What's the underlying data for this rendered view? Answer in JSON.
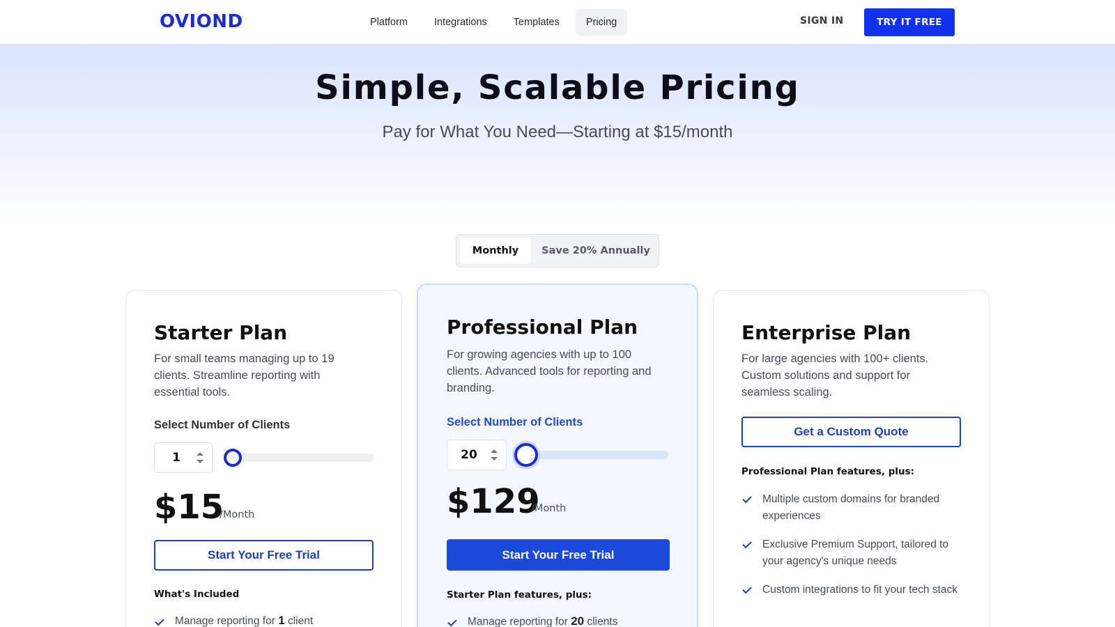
{
  "header": {
    "logo": "OVIOND",
    "nav": [
      "Platform",
      "Integrations",
      "Templates",
      "Pricing"
    ],
    "active_nav": "Pricing",
    "sign_in": "SIGN IN",
    "cta": "TRY IT FREE"
  },
  "hero": {
    "title": "Simple, Scalable Pricing",
    "subtitle": "Pay for What You Need—Starting at $15/month"
  },
  "billing_toggle": {
    "monthly": "Monthly",
    "annual": "Save 20% Annually",
    "selected": "Monthly"
  },
  "plans": {
    "starter": {
      "title": "Starter Plan",
      "description": "For small teams managing up to 19 clients. Streamline reporting with essential tools.",
      "select_label": "Select Number of Clients",
      "clients": "1",
      "slider_fraction": 0.0,
      "price": "$15",
      "period": "/Month",
      "cta": "Start Your Free Trial",
      "features_heading": "What's Included",
      "features": [
        {
          "pre": "Manage reporting for ",
          "num": "1",
          "post": " client"
        }
      ]
    },
    "pro": {
      "title": "Professional Plan",
      "description": "For growing agencies with up to 100 clients. Advanced tools for reporting and branding.",
      "select_label": "Select Number of Clients",
      "clients": "20",
      "slider_fraction": 0.0,
      "price": "$129",
      "period": "/Month",
      "cta": "Start Your Free Trial",
      "features_heading": "Starter Plan features, plus:",
      "features": [
        {
          "pre": "Manage reporting for ",
          "num": "20",
          "post": " clients"
        }
      ]
    },
    "enterprise": {
      "title": "Enterprise Plan",
      "description": "For large agencies with 100+ clients. Custom solutions and support for seamless scaling.",
      "cta": "Get a Custom Quote",
      "features_heading": "Professional Plan features, plus:",
      "features": [
        "Multiple custom domains for branded experiences",
        "Exclusive Premium Support, tailored to your agency's unique needs",
        "Custom integrations to fit your tech stack"
      ]
    }
  },
  "colors": {
    "brand": "#1b2bd6",
    "cta": "#1232f0",
    "accent_blue": "#1b49d9",
    "pro_label": "#2749c8"
  }
}
